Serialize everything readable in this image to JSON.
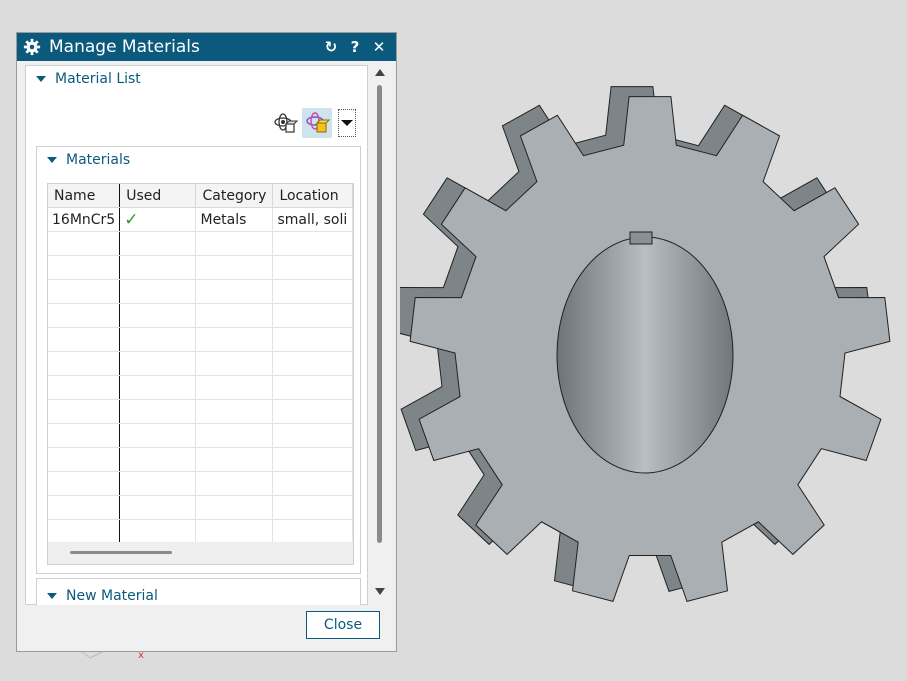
{
  "dialog": {
    "title": "Manage Materials",
    "icons": [
      "gear-icon",
      "reset-icon",
      "help-icon",
      "close-icon"
    ],
    "help_label": "?",
    "close_glyph": "✕",
    "reset_glyph": "↻"
  },
  "material_list": {
    "heading": "Material List",
    "toolbar": [
      "material-library-icon",
      "assign-material-icon",
      "dropdown-arrow-icon"
    ]
  },
  "materials": {
    "heading": "Materials",
    "columns": [
      "Name",
      "Used",
      "Category",
      "Location"
    ],
    "rows": [
      {
        "name": "16MnCr5",
        "used": "✓",
        "category": "Metals",
        "location": "small, soli"
      }
    ]
  },
  "new_material": {
    "heading": "New Material"
  },
  "buttons": {
    "close": "Close"
  },
  "colors": {
    "titlebar": "#0b5a7e",
    "accent": "#0b5a7e",
    "check": "#2a9d2a",
    "gear_face": "#a9afb3",
    "viewport_bg": "#dcdcdc"
  }
}
